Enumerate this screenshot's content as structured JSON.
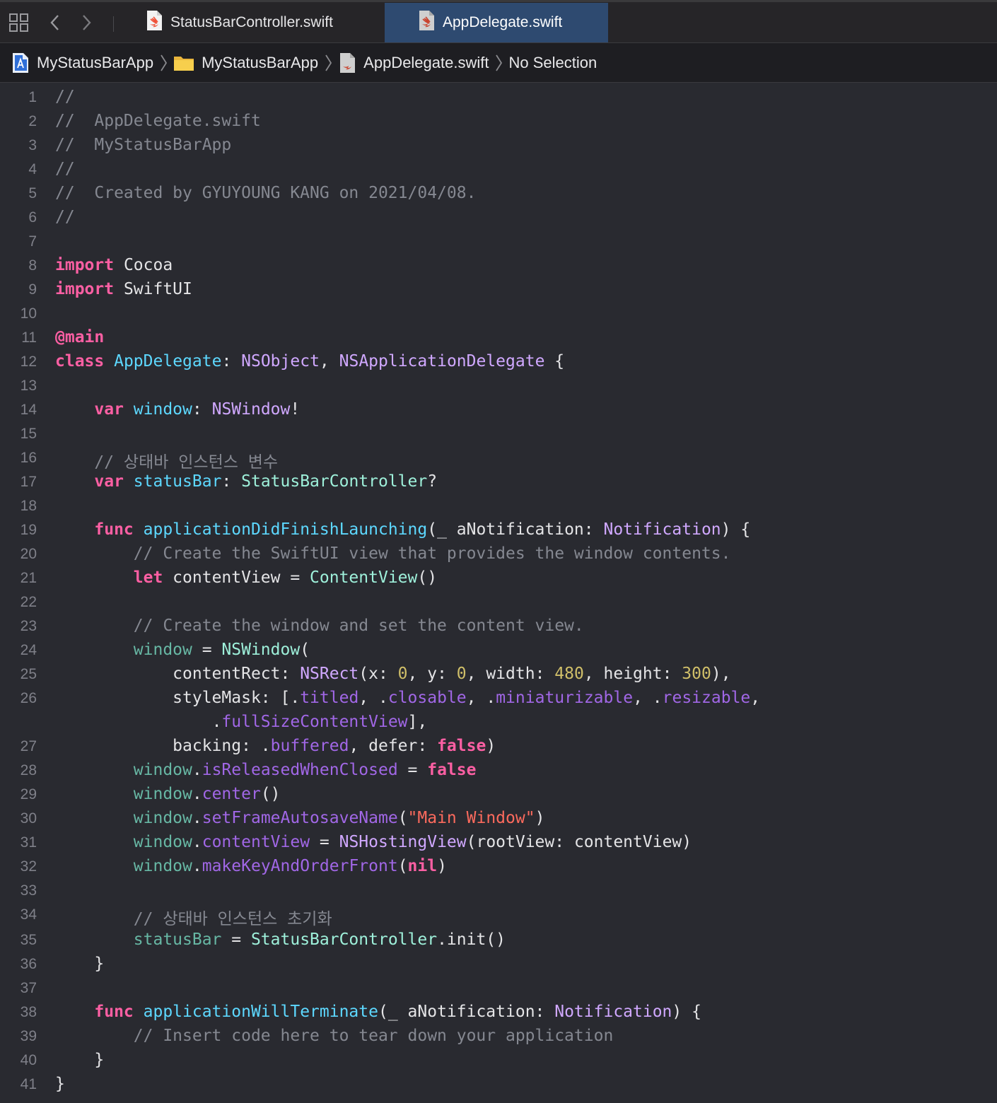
{
  "tabs": [
    {
      "label": "StatusBarController.swift",
      "active": false
    },
    {
      "label": "AppDelegate.swift",
      "active": true
    }
  ],
  "breadcrumb": {
    "project": "MyStatusBarApp",
    "folder": "MyStatusBarApp",
    "file": "AppDelegate.swift",
    "selection": "No Selection"
  },
  "line_numbers": [
    "1",
    "2",
    "3",
    "4",
    "5",
    "6",
    "7",
    "8",
    "9",
    "10",
    "11",
    "12",
    "13",
    "14",
    "15",
    "16",
    "17",
    "18",
    "19",
    "20",
    "21",
    "22",
    "23",
    "24",
    "25",
    "26",
    "",
    "27",
    "28",
    "29",
    "30",
    "31",
    "32",
    "33",
    "34",
    "35",
    "36",
    "37",
    "38",
    "39",
    "40",
    "41"
  ],
  "code": {
    "l1": "//",
    "l2": "//  AppDelegate.swift",
    "l3": "//  MyStatusBarApp",
    "l4": "//",
    "l5": "//  Created by GYUYOUNG KANG on 2021/04/08.",
    "l6": "//",
    "kw_import": "import",
    "cocoa": " Cocoa",
    "swiftui": " SwiftUI",
    "attr_main": "@main",
    "kw_class": "class",
    "cls_name": "AppDelegate",
    "colon_sp": ": ",
    "nsobject": "NSObject",
    "comma_sp": ", ",
    "nsappdelegate": "NSApplicationDelegate",
    "open_brace": " {",
    "kw_var": "var",
    "prop_window": "window",
    "nswindow": "NSWindow",
    "bang": "!",
    "comment_statusbar_var": "// 상태바 인스턴스 변수",
    "prop_statusbar": "statusBar",
    "statusbarcontroller": "StatusBarController",
    "question": "?",
    "kw_func": "func",
    "fn_didfinish": "applicationDidFinishLaunching",
    "param_open": "(_ aNotification: ",
    "notification": "Notification",
    "param_close": ") {",
    "comment_create_view": "// Create the SwiftUI view that provides the window contents.",
    "kw_let": "let",
    "content_view_decl": " contentView = ",
    "contentview_type": "ContentView",
    "parens": "()",
    "comment_create_window": "// Create the window and set the content view.",
    "window_ref": "window",
    "assign": " = ",
    "nswindow_open": "(",
    "content_rect": "contentRect: ",
    "nsrect": "NSRect",
    "rect_x": "(x: ",
    "num_0": "0",
    "rect_y": ", y: ",
    "rect_w": ", width: ",
    "num_480": "480",
    "rect_h": ", height: ",
    "num_300": "300",
    "rect_close": "),",
    "stylemask": "styleMask: [",
    "dot": ".",
    "titled": "titled",
    "closable": "closable",
    "miniaturizable": "miniaturizable",
    "resizable": "resizable",
    "comma_end": ",",
    "fullsize": "fullSizeContentView",
    "bracket_close": "],",
    "backing": "backing: ",
    "buffered": "buffered",
    "defer": ", defer: ",
    "kw_false": "false",
    "paren_close": ")",
    "is_released": "isReleasedWhenClosed",
    "center": "center",
    "set_autosave": "setFrameAutosaveName",
    "str_main_window": "\"Main Window\"",
    "content_view_prop": "contentView",
    "nshostingview": "NSHostingView",
    "root_view": "(rootView: contentView)",
    "make_key": "makeKeyAndOrderFront",
    "kw_nil": "nil",
    "comment_statusbar_init": "// 상태바 인스턴스 초기화",
    "statusbar_ref": "statusBar",
    "init_call": ".init()",
    "close_brace": "}",
    "fn_willterminate": "applicationWillTerminate",
    "comment_teardown": "// Insert code here to tear down your application"
  },
  "colors": {
    "background": "#292a30",
    "comment": "#858891",
    "keyword": "#fc5fa3",
    "type": "#d0a8ff",
    "declaration": "#5dd8ff",
    "number": "#d0bf69",
    "string": "#fc6a5d"
  },
  "icons": {
    "grid": "related-items-grid-icon",
    "back": "chevron-left-icon",
    "forward": "chevron-right-icon",
    "swift_file": "swift-file-icon",
    "project": "xcode-project-icon",
    "folder": "folder-icon"
  }
}
